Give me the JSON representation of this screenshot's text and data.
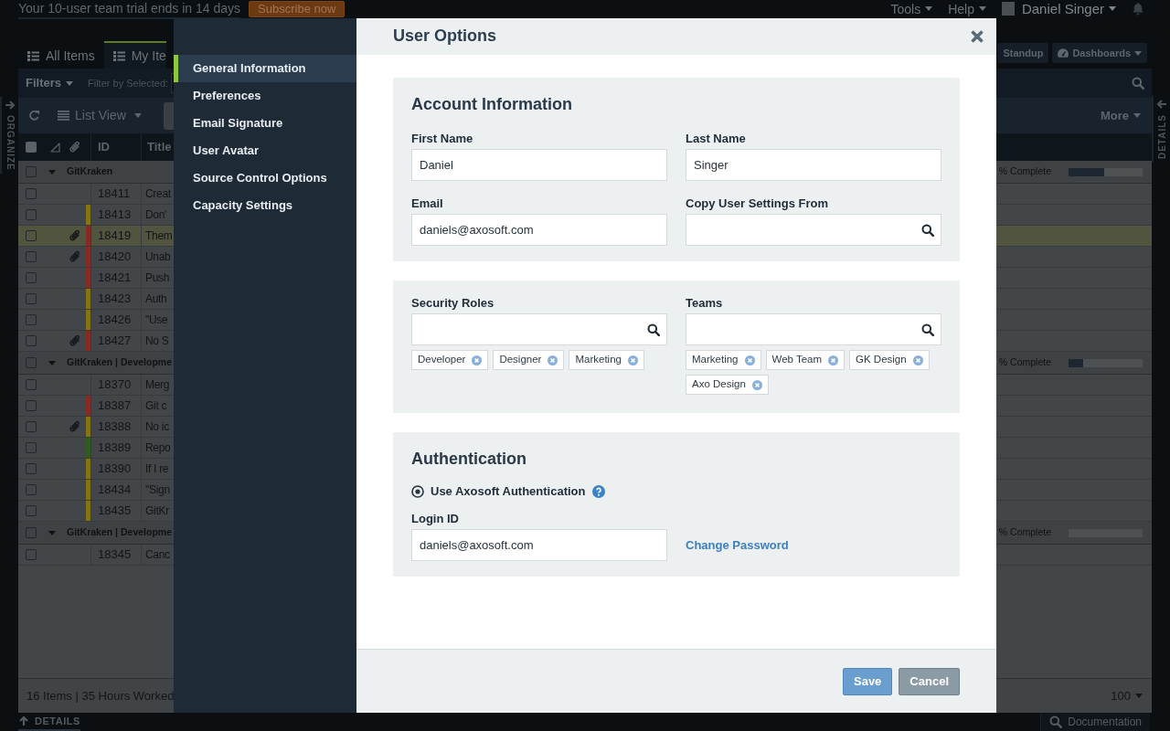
{
  "banner": {
    "text": "Your 10-user team trial ends in 14 days",
    "button": "Subscribe now"
  },
  "top_menu": [
    {
      "label": "Tools"
    },
    {
      "label": "Help"
    }
  ],
  "user": {
    "name": "Daniel Singer"
  },
  "side_panels": {
    "left": "ORGANIZE",
    "right": "DETAILS"
  },
  "view_tabs": [
    {
      "label": "All Items",
      "selected": false
    },
    {
      "label": "My Ite",
      "selected": true
    }
  ],
  "view_buttons": [
    {
      "kind": "standup",
      "label": "Standup"
    },
    {
      "kind": "dashboards",
      "label": "Dashboards"
    }
  ],
  "filter_bar": {
    "label": "Filters",
    "filter_label": "Filter by Selected:"
  },
  "toolbar": {
    "view": "List View",
    "more": "More"
  },
  "table": {
    "select_all": {
      "checked": false
    },
    "columns": [
      "ID",
      "Title"
    ],
    "groups": [
      {
        "name": "GitKraken",
        "progress_text": "% Complete",
        "level": 0.48,
        "expanded": true,
        "checked": false,
        "rows": [
          {
            "id": "18411",
            "title": "Creat",
            "attachment": false,
            "checked": false,
            "selected": false
          },
          {
            "id": "18413",
            "title": "Don'",
            "attachment": false,
            "checked": false,
            "selected": false,
            "color": "#857412"
          },
          {
            "id": "18419",
            "title": "Them",
            "attachment": true,
            "checked": false,
            "selected": true,
            "color": "#862a23"
          },
          {
            "id": "18420",
            "title": "Unab",
            "attachment": true,
            "checked": false,
            "selected": false,
            "color": "#862a23"
          },
          {
            "id": "18421",
            "title": "Push",
            "attachment": false,
            "checked": false,
            "selected": false,
            "color": "#862a23"
          },
          {
            "id": "18423",
            "title": "Auth",
            "attachment": false,
            "checked": false,
            "selected": false,
            "color": "#857412"
          },
          {
            "id": "18426",
            "title": "\"Use",
            "attachment": false,
            "checked": false,
            "selected": false,
            "color": "#857412"
          },
          {
            "id": "18427",
            "title": "No S",
            "attachment": true,
            "checked": false,
            "selected": false,
            "color": "#862a23"
          }
        ]
      },
      {
        "name": "GitKraken | Developme",
        "progress_text": "% Complete",
        "level": 0.2,
        "expanded": true,
        "checked": false,
        "rows": [
          {
            "id": "18370",
            "title": "Merg",
            "attachment": false,
            "checked": false,
            "selected": false
          },
          {
            "id": "18387",
            "title": "Git c",
            "attachment": false,
            "checked": false,
            "selected": false,
            "color": "#862a23"
          },
          {
            "id": "18388",
            "title": "No ic",
            "attachment": true,
            "checked": false,
            "selected": false,
            "color": "#857412"
          },
          {
            "id": "18389",
            "title": "Repo",
            "attachment": false,
            "checked": false,
            "selected": false,
            "color": "#2f5a20"
          },
          {
            "id": "18390",
            "title": "If I re",
            "attachment": false,
            "checked": false,
            "selected": false,
            "color": "#857412"
          },
          {
            "id": "18434",
            "title": "\"Sign",
            "attachment": false,
            "checked": false,
            "selected": false,
            "color": "#857412"
          },
          {
            "id": "18435",
            "title": "GitKr",
            "attachment": false,
            "checked": false,
            "selected": false,
            "color": "#857412"
          }
        ]
      },
      {
        "name": "GitKraken | Developme",
        "progress_text": "% Complete",
        "level": 0,
        "expanded": true,
        "checked": false,
        "rows": [
          {
            "id": "18345",
            "title": "Canc",
            "attachment": false,
            "checked": false,
            "selected": false
          }
        ]
      }
    ]
  },
  "summary": {
    "text": "16 Items | 35 Hours Worked",
    "page_size": "100"
  },
  "bottom_bar": {
    "details": "DETAILS",
    "docs": "Documentation"
  },
  "dialog": {
    "title": "User Options",
    "nav": [
      {
        "label": "General Information",
        "selected": true
      },
      {
        "label": "Preferences",
        "selected": false
      },
      {
        "label": "Email Signature",
        "selected": false
      },
      {
        "label": "User Avatar",
        "selected": false
      },
      {
        "label": "Source Control Options",
        "selected": false
      },
      {
        "label": "Capacity Settings",
        "selected": false
      }
    ],
    "sections": [
      {
        "heading": "Account Information",
        "fields": [
          {
            "kind": "text",
            "label": "First Name",
            "value": "Daniel"
          },
          {
            "kind": "text",
            "label": "Last Name",
            "value": "Singer"
          },
          {
            "kind": "text",
            "label": "Email",
            "value": "daniels@axosoft.com"
          },
          {
            "kind": "search",
            "label": "Copy User Settings From"
          }
        ]
      },
      {
        "fields": [
          {
            "kind": "search",
            "label": "Security Roles",
            "tags": [
              "Developer",
              "Designer",
              "Marketing"
            ]
          },
          {
            "kind": "search",
            "label": "Teams",
            "tags": [
              "Marketing",
              "Web Team",
              "GK Design",
              "Axo Design"
            ]
          }
        ]
      },
      {
        "heading": "Authentication",
        "fields": [
          {
            "kind": "radio",
            "label": "Use Axosoft Authentication",
            "selected": true
          },
          {
            "kind": "text",
            "label": "Login ID",
            "value": "daniels@axosoft.com"
          },
          {
            "kind": "link",
            "label": "Change Password"
          }
        ]
      }
    ],
    "buttons": [
      {
        "kind": "primary",
        "label": "Save"
      },
      {
        "kind": "secondary",
        "label": "Cancel"
      }
    ]
  }
}
